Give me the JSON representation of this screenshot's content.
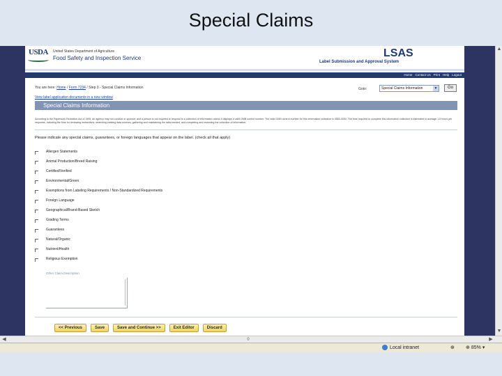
{
  "slide": {
    "title": "Special Claims"
  },
  "header": {
    "usda_logo": "USDA",
    "department": "United States Department of Agriculture",
    "agency": "Food Safety and Inspection Service",
    "app_title": "LSAS",
    "app_subtitle": "Label Submission and Approval System",
    "nav_links": [
      "Home",
      "Contact Us",
      "Print",
      "Help",
      "Logout"
    ]
  },
  "breadcrumb": {
    "prefix": "You are here:",
    "links": [
      "Home",
      "Form 7234"
    ],
    "current": "Step 3 - Special Claims Information"
  },
  "goto": {
    "label": "Goto:",
    "selected": "Special Claims Information",
    "button": "Go"
  },
  "view_link": "View label application documents in a new window",
  "section_title": "Special Claims Information",
  "disclaimer": "According to the Paperwork Reduction Act of 1995, an agency may not conduct or sponsor, and a person is not required to respond to a collection of information unless it displays a valid OMB control number. The valid OMB control number for this information collection is 0583-0092. The time required to complete this information collection is estimated to average 1.5 hours per response, including the time for reviewing instructions, searching existing data sources, gathering and maintaining the data needed, and completing and reviewing the collection of information.",
  "instruction": "Please indicate any special claims, guarantees, or foreign languages that appear on the label. (check all that apply)",
  "claims": [
    "Allergen Statements",
    "Animal Production/Breed Raising",
    "Certified/Verified",
    "Environmental/Green",
    "Exemptions from Labeling Requirements / Non-Standardized Requirements",
    "Foreign Language",
    "Geographical/Brand-Based Sketch",
    "Grading Terms",
    "Guarantees",
    "Natural/Organic",
    "Nutrient/Health",
    "Religious Exemption"
  ],
  "other_label": "Other Claim Description",
  "buttons": [
    "<< Previous",
    "Save",
    "Save and Continue >>",
    "Exit Editor",
    "Discard"
  ],
  "statusbar": {
    "zone": "Local intranet",
    "zoom": "85%"
  }
}
